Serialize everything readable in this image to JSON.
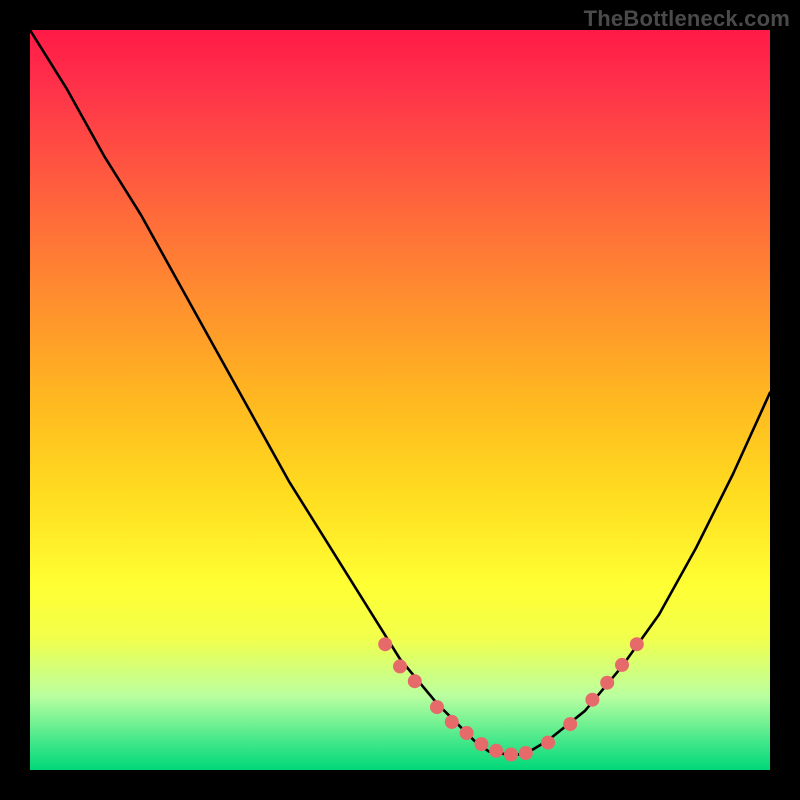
{
  "watermark": "TheBottleneck.com",
  "chart_data": {
    "type": "line",
    "title": "",
    "xlabel": "",
    "ylabel": "",
    "xlim": [
      0,
      100
    ],
    "ylim": [
      0,
      100
    ],
    "grid": false,
    "legend": false,
    "background_gradient": {
      "direction": "top-to-bottom",
      "stops": [
        {
          "pos": 0,
          "color": "#ff1a47"
        },
        {
          "pos": 50,
          "color": "#ffb820"
        },
        {
          "pos": 75,
          "color": "#ffff33"
        },
        {
          "pos": 100,
          "color": "#00d879"
        }
      ]
    },
    "series": [
      {
        "name": "bottleneck-curve",
        "color": "#000000",
        "x": [
          0,
          5,
          10,
          15,
          20,
          25,
          30,
          35,
          40,
          45,
          50,
          55,
          60,
          62,
          65,
          67,
          70,
          75,
          80,
          85,
          90,
          95,
          100
        ],
        "y": [
          100,
          92,
          83,
          75,
          66,
          57,
          48,
          39,
          31,
          23,
          15,
          9,
          4,
          2.5,
          2,
          2.2,
          4,
          8,
          14,
          21,
          30,
          40,
          51
        ]
      }
    ],
    "scatter": {
      "name": "highlight-dots",
      "color": "#e66a6a",
      "radius_px": 7,
      "x": [
        48,
        50,
        52,
        55,
        57,
        59,
        61,
        63,
        65,
        67,
        70,
        73,
        76,
        78,
        80,
        82
      ],
      "y": [
        17,
        14,
        12,
        8.5,
        6.5,
        5,
        3.5,
        2.6,
        2.1,
        2.3,
        3.7,
        6.2,
        9.5,
        11.8,
        14.2,
        17
      ]
    }
  }
}
